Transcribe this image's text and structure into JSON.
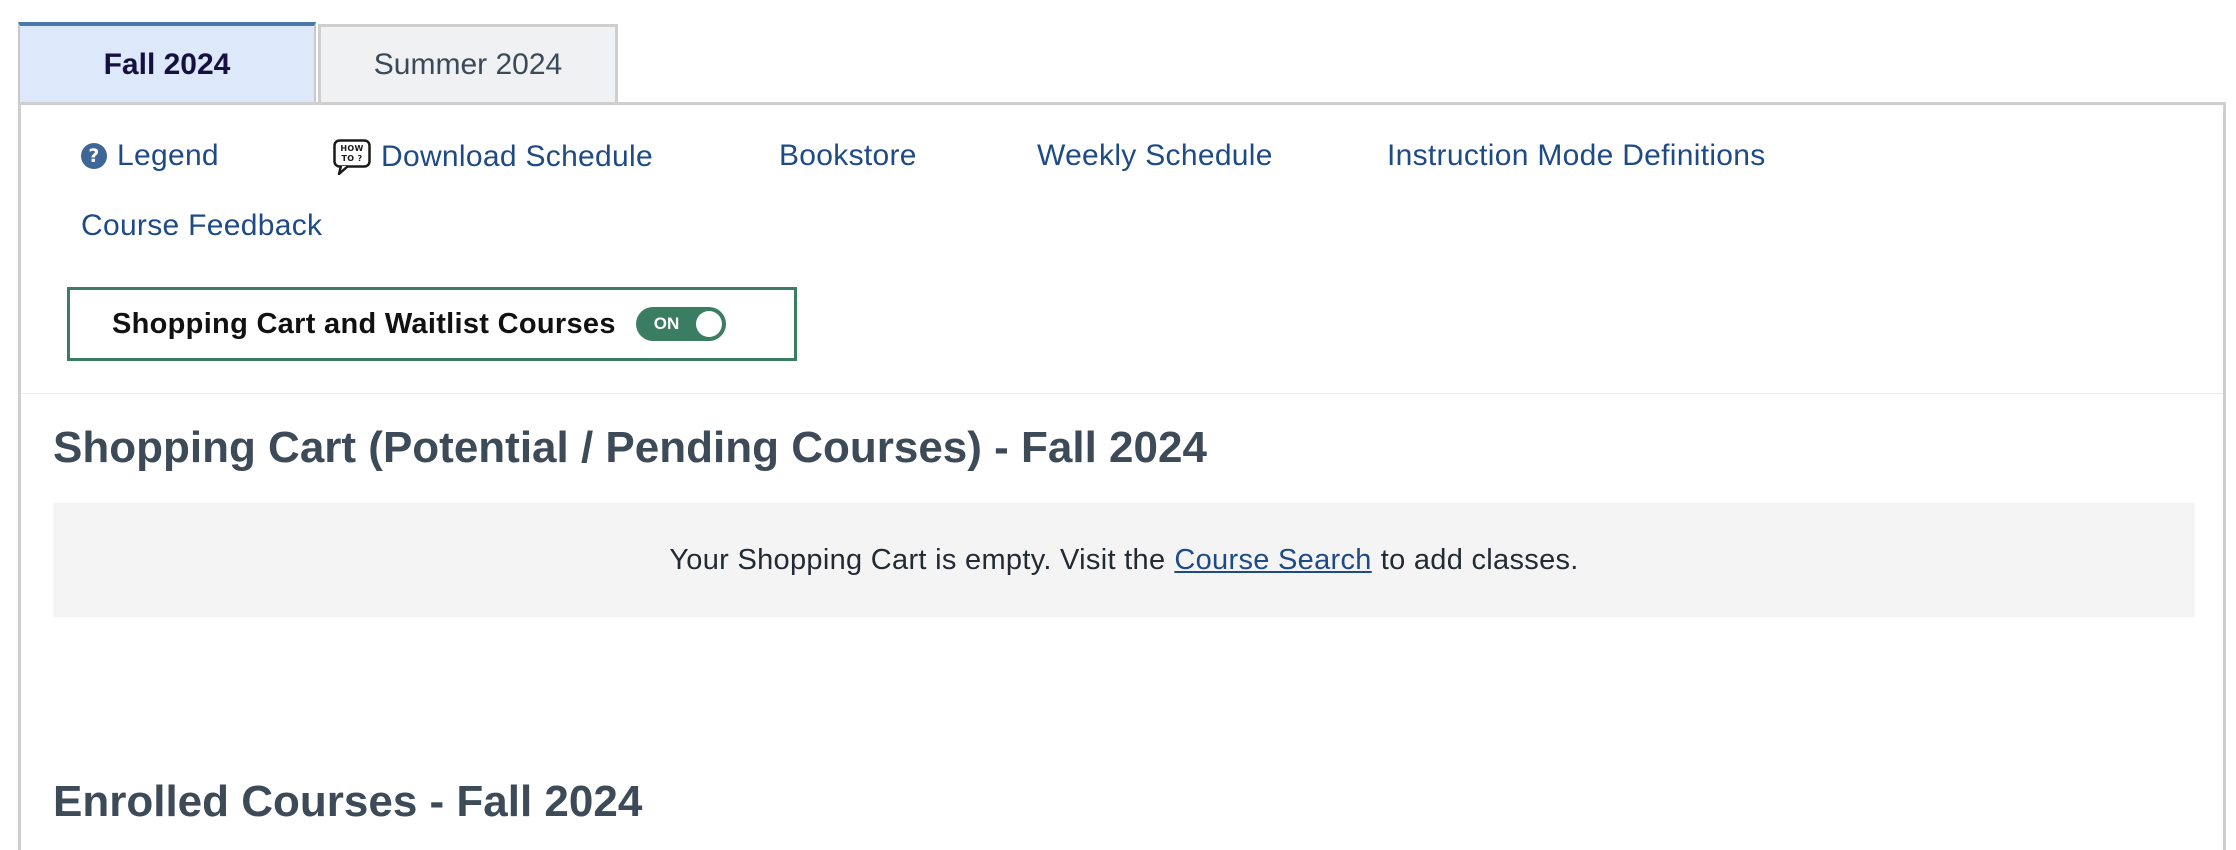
{
  "tabs": [
    {
      "label": "Fall 2024",
      "active": true
    },
    {
      "label": "Summer 2024",
      "active": false
    }
  ],
  "links": {
    "legend": "Legend",
    "download": "Download Schedule",
    "bookstore": "Bookstore",
    "weekly": "Weekly Schedule",
    "instruction": "Instruction Mode Definitions",
    "feedback": "Course Feedback"
  },
  "icons": {
    "legend_icon": "question-circle-icon",
    "download_icon": "how-to-icon",
    "howto_text_top": "HOW",
    "howto_text_bottom": "TO ?"
  },
  "toggle": {
    "label": "Shopping Cart and Waitlist Courses",
    "state": "ON"
  },
  "shopping_cart": {
    "title": "Shopping Cart (Potential / Pending Courses) - Fall 2024",
    "empty_prefix": "Your Shopping Cart is empty. Visit the",
    "empty_link": "Course Search",
    "empty_suffix": "to add classes."
  },
  "enrolled": {
    "title": "Enrolled Courses - Fall 2024"
  },
  "colors": {
    "accent_blue": "#1e4a85",
    "toggle_green": "#3a7d63",
    "active_tab_bg": "#dde9fb"
  }
}
